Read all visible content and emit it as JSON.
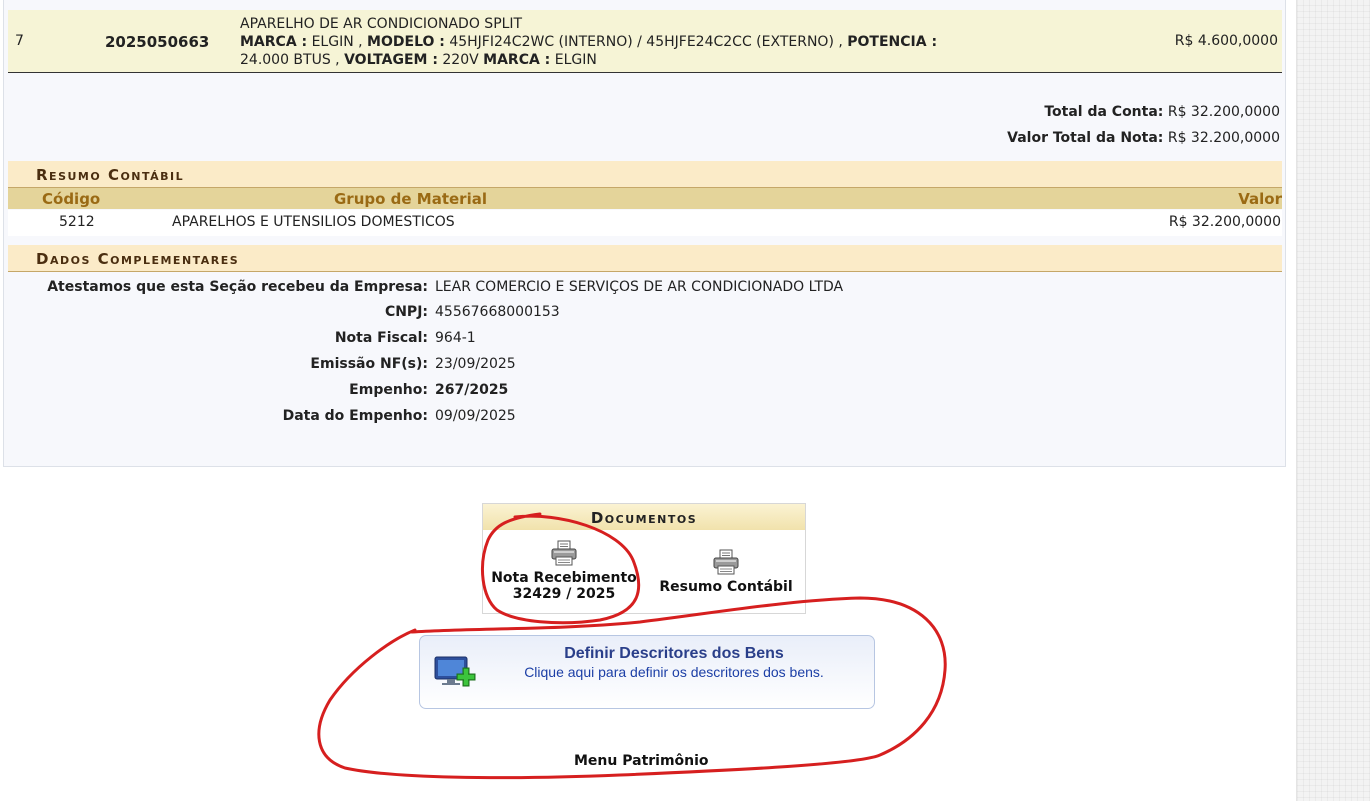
{
  "item": {
    "number": "7",
    "code": "2025050663",
    "line1": "APARELHO DE AR CONDICIONADO SPLIT",
    "marca_label": "MARCA :",
    "marca_value": " ELGIN , ",
    "modelo_label": "MODELO :",
    "modelo_value": " 45HJFI24C2WC (INTERNO) / 45HJFE24C2CC (EXTERNO) , ",
    "potencia_label": "POTENCIA :",
    "potencia_value": " 24.000 BTUS , ",
    "voltagem_label": "VOLTAGEM :",
    "voltagem_value": " 220V ",
    "marca2_label": "MARCA :",
    "marca2_value": " ELGIN",
    "price": "R$ 4.600,0000"
  },
  "totals": {
    "conta_label": "Total da Conta:",
    "conta_value": "R$ 32.200,0000",
    "nota_label": "Valor Total da Nota:",
    "nota_value": "R$ 32.200,0000"
  },
  "resumo": {
    "title": "Resumo Contábil",
    "col_codigo": "Código",
    "col_grupo": "Grupo de Material",
    "col_valor": "Valor",
    "row": {
      "codigo": "5212",
      "grupo": "APARELHOS E UTENSILIOS DOMESTICOS",
      "valor": "R$ 32.200,0000"
    }
  },
  "dados": {
    "title": "Dados Complementares",
    "rows": [
      {
        "label": "Atestamos que esta Seção recebeu da Empresa:",
        "value": "LEAR COMERCIO E SERVIÇOS DE AR CONDICIONADO LTDA"
      },
      {
        "label": "CNPJ:",
        "value": "45567668000153"
      },
      {
        "label": "Nota Fiscal:",
        "value": "964-1"
      },
      {
        "label": "Emissão NF(s):",
        "value": "23/09/2025"
      },
      {
        "label": "Empenho:",
        "value": "267/2025"
      },
      {
        "label": "Data do Empenho:",
        "value": "09/09/2025"
      }
    ]
  },
  "documentos": {
    "title": "Documentos",
    "nota_line1": "Nota Recebimento",
    "nota_line2": "32429 / 2025",
    "resumo_label": "Resumo Contábil"
  },
  "definir": {
    "title": "Definir Descritores dos Bens",
    "subtitle": "Clique aqui para definir os descritores dos bens."
  },
  "menu_patrimonio": "Menu Patrimônio",
  "colors": {
    "annotation": "#d61f1f",
    "section_header_bg": "#fbebc8",
    "column_header_bg": "#e4d49a",
    "item_row_bg": "#f6f4d6",
    "link_blue": "#1c3fa6"
  }
}
